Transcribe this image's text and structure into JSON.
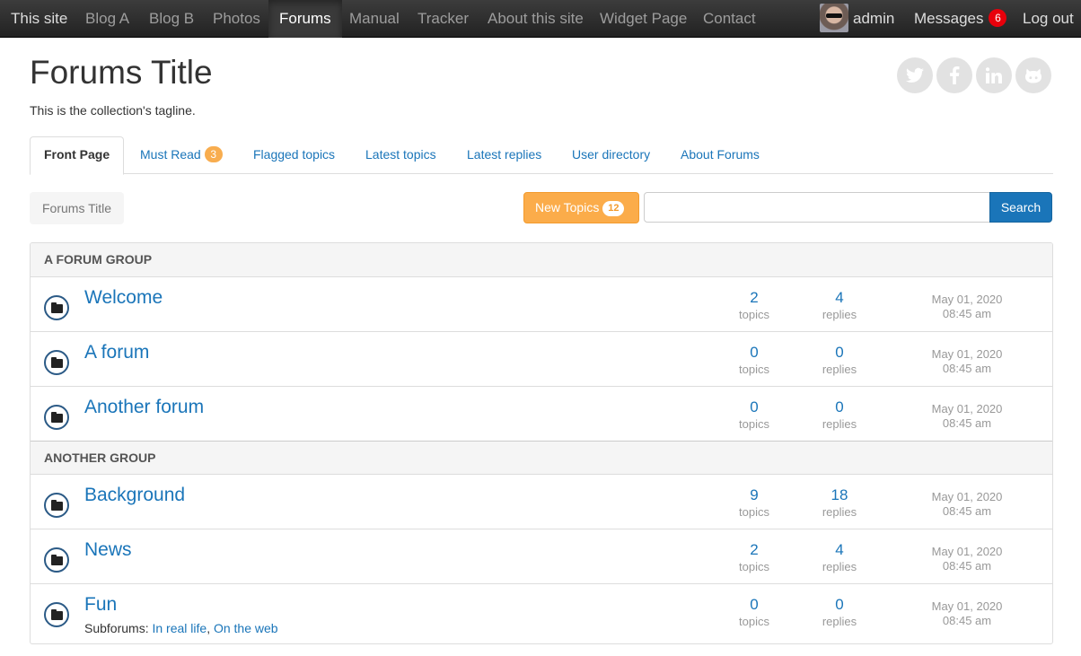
{
  "nav": {
    "brand": "This site",
    "items": [
      "Blog A",
      "Blog B",
      "Photos",
      "Forums",
      "Manual",
      "Tracker",
      "About this site",
      "Widget Page",
      "Contact"
    ],
    "active": "Forums",
    "user": "admin",
    "messages_label": "Messages",
    "messages_count": "6",
    "logout": "Log out"
  },
  "header": {
    "title": "Forums Title",
    "tagline": "This is the collection's tagline.",
    "social_icons": [
      "twitter-icon",
      "facebook-icon",
      "linkedin-icon",
      "github-icon"
    ]
  },
  "tabs": {
    "front_page": "Front Page",
    "must_read": "Must Read",
    "must_read_count": "3",
    "flagged": "Flagged topics",
    "latest_topics": "Latest topics",
    "latest_replies": "Latest replies",
    "user_directory": "User directory",
    "about": "About Forums"
  },
  "toolbar": {
    "breadcrumb": "Forums Title",
    "new_topics_label": "New Topics",
    "new_topics_count": "12",
    "search_placeholder": "",
    "search_button": "Search"
  },
  "groups": [
    {
      "name": "A FORUM GROUP",
      "forums": [
        {
          "name": "Welcome",
          "topics": "2",
          "replies": "4",
          "date": "May 01, 2020",
          "time": "08:45 am"
        },
        {
          "name": "A forum",
          "topics": "0",
          "replies": "0",
          "date": "May 01, 2020",
          "time": "08:45 am"
        },
        {
          "name": "Another forum",
          "topics": "0",
          "replies": "0",
          "date": "May 01, 2020",
          "time": "08:45 am"
        }
      ]
    },
    {
      "name": "ANOTHER GROUP",
      "forums": [
        {
          "name": "Background",
          "topics": "9",
          "replies": "18",
          "date": "May 01, 2020",
          "time": "08:45 am"
        },
        {
          "name": "News",
          "topics": "2",
          "replies": "4",
          "date": "May 01, 2020",
          "time": "08:45 am"
        },
        {
          "name": "Fun",
          "topics": "0",
          "replies": "0",
          "date": "May 01, 2020",
          "time": "08:45 am",
          "subforums_label": "Subforums:",
          "subforums": [
            "In real life",
            "On the web"
          ]
        }
      ]
    }
  ],
  "labels": {
    "topics": "topics",
    "replies": "replies"
  },
  "colors": {
    "link": "#1a75b9",
    "accent_orange": "#fbac4a",
    "badge_red": "#e8000b"
  }
}
